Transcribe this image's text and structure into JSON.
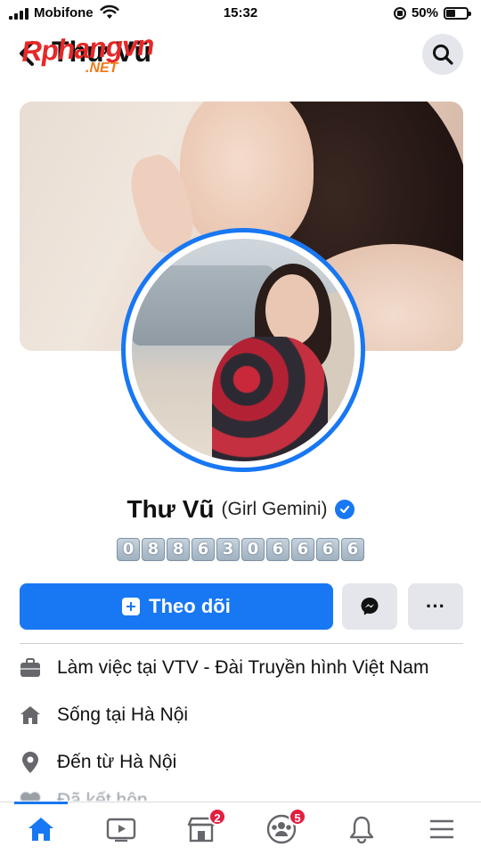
{
  "status_bar": {
    "carrier": "Mobifone",
    "time": "15:32",
    "battery": "50%"
  },
  "header": {
    "profile_name_short": "Thư Vũ",
    "watermark_text": "Rphangvn",
    "watermark_sub": ".NET"
  },
  "profile": {
    "name": "Thư Vũ",
    "alternate_name": "(Girl Gemini)",
    "phone_digits": [
      "0",
      "8",
      "8",
      "6",
      "3",
      "0",
      "6",
      "6",
      "6",
      "6"
    ]
  },
  "actions": {
    "follow_label": "Theo dõi",
    "more_label": "···"
  },
  "details": [
    {
      "icon": "briefcase-icon",
      "text": "Làm việc tại VTV - Đài Truyền hình Việt Nam"
    },
    {
      "icon": "home-icon",
      "text": "Sống tại Hà Nội"
    },
    {
      "icon": "location-pin-icon",
      "text": "Đến từ Hà Nội"
    },
    {
      "icon": "heart-icon",
      "text": "Đã kết hôn"
    }
  ],
  "bottom_nav": {
    "marketplace_badge": "2",
    "groups_badge": "5"
  },
  "colors": {
    "accent": "#1877f2",
    "badge": "#e41e3f",
    "button_gray": "#e4e6eb"
  }
}
